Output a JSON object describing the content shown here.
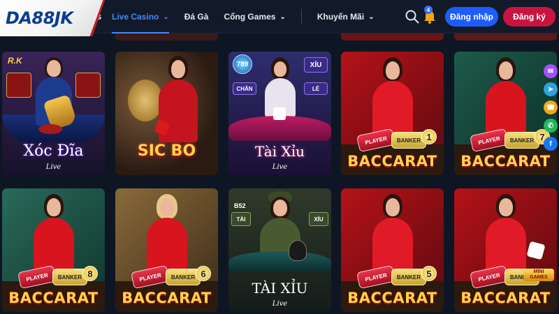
{
  "header": {
    "logo": "DA88JK",
    "nav_stub": "s",
    "nav": [
      {
        "label": "Live Casino",
        "active": true,
        "dropdown": true
      },
      {
        "label": "Đá Gà",
        "active": false,
        "dropdown": false
      },
      {
        "label": "Cổng Games",
        "active": false,
        "dropdown": true
      },
      {
        "label": "Khuyến Mãi",
        "active": false,
        "dropdown": true
      }
    ],
    "notification_count": "4",
    "login_label": "Đăng nhập",
    "register_label": "Đăng ký"
  },
  "games": [
    {
      "title": "Xóc Đĩa",
      "subtitle": "Live"
    },
    {
      "title": "SIC BO",
      "subtitle": ""
    },
    {
      "title": "Tài Xỉu",
      "subtitle": "Live"
    },
    {
      "title": "BACCARAT",
      "badge": "1",
      "player": "PLAYER",
      "banker": "BANKER"
    },
    {
      "title": "BACCARAT",
      "badge": "7",
      "player": "PLAYER",
      "banker": "BANKER"
    },
    {
      "title": "BACCARAT",
      "badge": "8",
      "player": "PLAYER",
      "banker": "BANKER"
    },
    {
      "title": "BACCARAT",
      "badge": "6",
      "player": "PLAYER",
      "banker": "BANKER"
    },
    {
      "title": "TÀI XỈU",
      "subtitle": "Live",
      "tai": "TÀI",
      "xiu": "XỈU",
      "room": "B52"
    },
    {
      "title": "BACCARAT",
      "badge": "5",
      "player": "PLAYER",
      "banker": "BANKER"
    },
    {
      "title": "BACCARAT",
      "badge": "MINI GAMES",
      "player": "PLAYER",
      "banker": "BANKER"
    }
  ],
  "game_texts": {
    "xocdia_logo": "R.K",
    "taixiu_logo": "789",
    "taixiu_xiu": "XỈU",
    "taixiu_chan": "CHẴN",
    "taixiu_le": "LẺ"
  },
  "social": [
    {
      "name": "messenger-icon",
      "color": "#a64dff",
      "glyph": "✉"
    },
    {
      "name": "telegram-icon",
      "color": "#2aa3e0",
      "glyph": "➤"
    },
    {
      "name": "contact-icon",
      "color": "#f0a818",
      "glyph": "☎"
    },
    {
      "name": "phone-icon",
      "color": "#1fb85a",
      "glyph": "✆"
    },
    {
      "name": "facebook-icon",
      "color": "#1877f2",
      "glyph": "f"
    }
  ]
}
